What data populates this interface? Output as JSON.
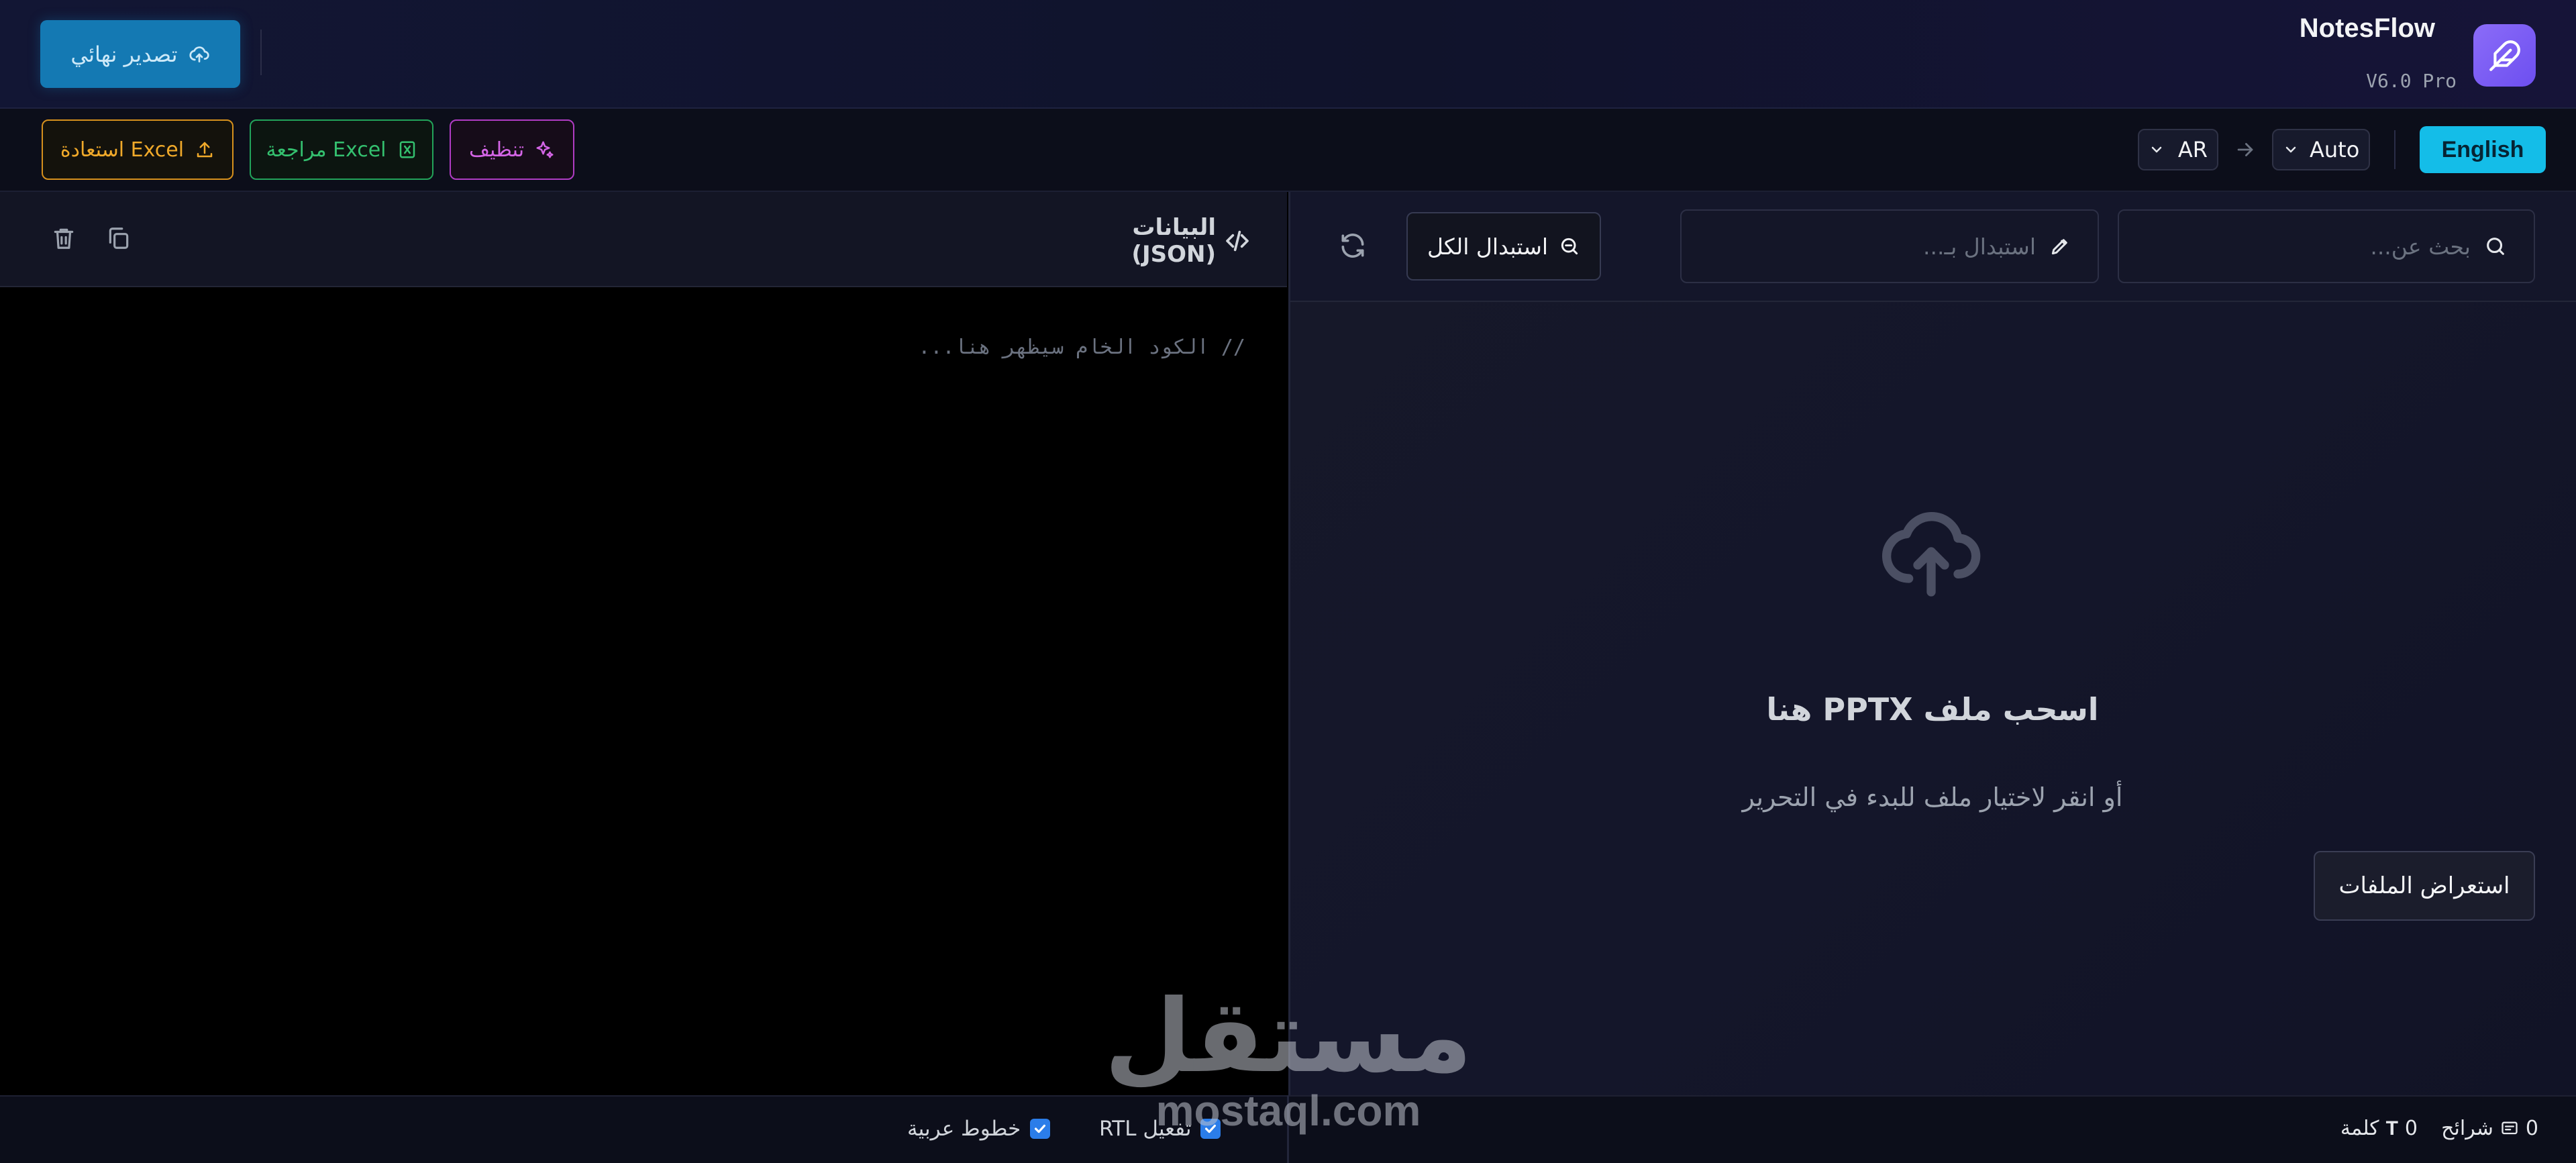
{
  "app": {
    "name": "NotesFlow",
    "version": "V6.0 Pro",
    "brand_color": "#7c5cf5"
  },
  "header": {
    "export_label": "تصدير نهائي"
  },
  "toolbar": {
    "english_label": "English",
    "source_lang": "Auto",
    "target_lang": "AR",
    "clean_label": "تنظيف",
    "review_excel_label": "مراجعة Excel",
    "restore_excel_label": "استعادة Excel"
  },
  "search": {
    "search_placeholder": "بحث عن...",
    "replace_placeholder": "استبدال بـ...",
    "replace_all_label": "استبدال الكل"
  },
  "dropzone": {
    "title": "اسحب ملف PPTX هنا",
    "subtitle": "أو انقر لاختيار ملف للبدء في التحرير",
    "browse_label": "استعراض الملفات"
  },
  "json_panel": {
    "title": "البيانات (JSON)",
    "placeholder": "// الكود الخام سيظهر هنا..."
  },
  "options": {
    "rtl_label": "تفعيل RTL",
    "arabic_fonts_label": "خطوط عربية"
  },
  "status": {
    "slides_count": "0",
    "slides_label": "شرائح",
    "words_count": "0",
    "words_label": "كلمة"
  },
  "watermark": {
    "arabic": "مستقل",
    "latin": "mostaql.com"
  }
}
